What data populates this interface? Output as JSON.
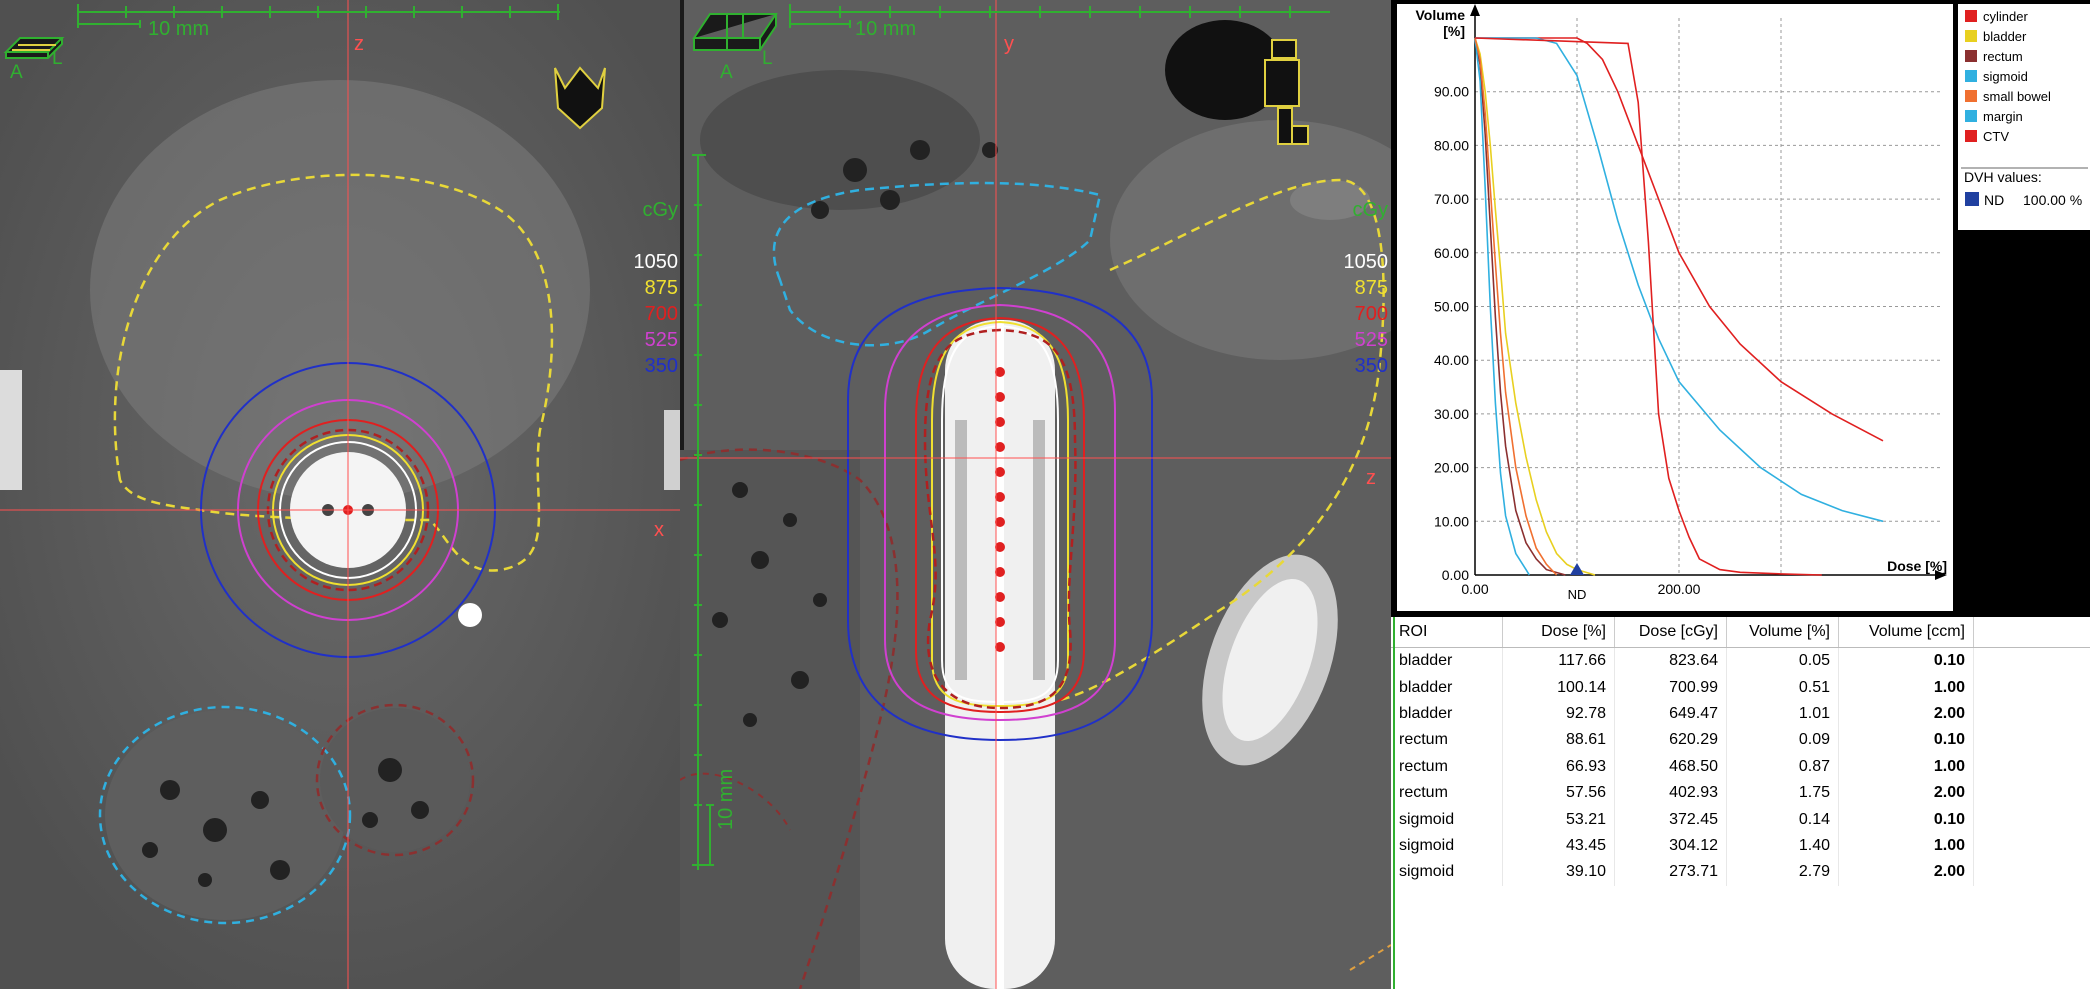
{
  "axial_view": {
    "scale_label": "10 mm",
    "orientation_labels": [
      "A",
      "L"
    ],
    "axis_top_label": "z",
    "axis_side_label": "x",
    "dose_unit": "cGy",
    "isodose_levels": [
      {
        "value": "1050",
        "color": "#ffffff"
      },
      {
        "value": "875",
        "color": "#f0e030"
      },
      {
        "value": "700",
        "color": "#e02020"
      },
      {
        "value": "525",
        "color": "#d040d0"
      },
      {
        "value": "350",
        "color": "#2030c8"
      }
    ]
  },
  "sagittal_view": {
    "scale_label": "10 mm",
    "orientation_labels": [
      "A",
      "L"
    ],
    "axis_top_label": "y",
    "axis_side_label": "z",
    "ruler_label": "10 mm",
    "dose_unit": "cGy",
    "isodose_levels": [
      {
        "value": "1050",
        "color": "#ffffff"
      },
      {
        "value": "875",
        "color": "#f0e030"
      },
      {
        "value": "700",
        "color": "#e02020"
      },
      {
        "value": "525",
        "color": "#d040d0"
      },
      {
        "value": "350",
        "color": "#2030c8"
      }
    ]
  },
  "dvh_values_label": "DVH values:",
  "dvh_marker": {
    "label": "ND",
    "value": "100.00 %",
    "color": "#2040a0"
  },
  "roi_table": {
    "headers": [
      "ROI",
      "Dose [%]",
      "Dose [cGy]",
      "Volume [%]",
      "Volume [ccm]"
    ],
    "rows": [
      [
        "bladder",
        "117.66",
        "823.64",
        "0.05",
        "0.10"
      ],
      [
        "bladder",
        "100.14",
        "700.99",
        "0.51",
        "1.00"
      ],
      [
        "bladder",
        "92.78",
        "649.47",
        "1.01",
        "2.00"
      ],
      [
        "rectum",
        "88.61",
        "620.29",
        "0.09",
        "0.10"
      ],
      [
        "rectum",
        "66.93",
        "468.50",
        "0.87",
        "1.00"
      ],
      [
        "rectum",
        "57.56",
        "402.93",
        "1.75",
        "2.00"
      ],
      [
        "sigmoid",
        "53.21",
        "372.45",
        "0.14",
        "0.10"
      ],
      [
        "sigmoid",
        "43.45",
        "304.12",
        "1.40",
        "1.00"
      ],
      [
        "sigmoid",
        "39.10",
        "273.71",
        "2.79",
        "2.00"
      ]
    ]
  },
  "chart_data": {
    "type": "line",
    "title": "",
    "xlabel": "Dose [%]",
    "ylabel": "Volume [%]",
    "xlim": [
      0,
      400
    ],
    "ylim": [
      0,
      100
    ],
    "x_ticks": [
      "0.00",
      "200.00"
    ],
    "y_ticks": [
      "0.00",
      "10.00",
      "20.00",
      "30.00",
      "40.00",
      "50.00",
      "60.00",
      "70.00",
      "80.00",
      "90.00"
    ],
    "grid": true,
    "legend_position": "right",
    "marker": {
      "label": "ND",
      "x": 100
    },
    "series": [
      {
        "name": "cylinder",
        "color": "#e02020",
        "x": [
          0,
          100,
          110,
          125,
          140,
          160,
          180,
          200,
          230,
          260,
          300,
          350,
          400
        ],
        "y": [
          100,
          100,
          99,
          96,
          90,
          80,
          70,
          60,
          50,
          43,
          36,
          30,
          25
        ]
      },
      {
        "name": "bladder",
        "color": "#e8d020",
        "x": [
          0,
          5,
          10,
          15,
          20,
          25,
          30,
          40,
          50,
          60,
          70,
          80,
          90,
          100,
          117.66
        ],
        "y": [
          100,
          97,
          90,
          80,
          68,
          57,
          45,
          32,
          22,
          14,
          8,
          4,
          2,
          1,
          0
        ]
      },
      {
        "name": "rectum",
        "color": "#8b3030",
        "x": [
          0,
          5,
          10,
          15,
          20,
          25,
          30,
          40,
          50,
          60,
          70,
          88.61
        ],
        "y": [
          100,
          95,
          82,
          65,
          48,
          34,
          24,
          12,
          6,
          3,
          1,
          0
        ]
      },
      {
        "name": "sigmoid",
        "color": "#30b0e0",
        "x": [
          0,
          5,
          10,
          15,
          20,
          25,
          30,
          40,
          50,
          53.21
        ],
        "y": [
          100,
          92,
          72,
          50,
          32,
          19,
          11,
          4,
          1,
          0
        ]
      },
      {
        "name": "small bowel",
        "color": "#f07030",
        "x": [
          0,
          5,
          10,
          15,
          20,
          25,
          30,
          40,
          50,
          60,
          70,
          80
        ],
        "y": [
          100,
          96,
          86,
          72,
          58,
          45,
          34,
          20,
          11,
          5,
          2,
          0
        ]
      },
      {
        "name": "margin",
        "color": "#30b0e0",
        "x": [
          0,
          60,
          80,
          100,
          120,
          140,
          160,
          180,
          200,
          240,
          280,
          320,
          360,
          400
        ],
        "y": [
          100,
          100,
          99,
          93,
          80,
          66,
          54,
          44,
          36,
          27,
          20,
          15,
          12,
          10
        ]
      },
      {
        "name": "CTV",
        "color": "#e02020",
        "x": [
          0,
          150,
          160,
          170,
          180,
          190,
          200,
          210,
          220,
          240,
          260,
          300,
          340
        ],
        "y": [
          100,
          99,
          88,
          62,
          30,
          18,
          12,
          7,
          3,
          1,
          0.5,
          0.2,
          0
        ]
      }
    ]
  }
}
